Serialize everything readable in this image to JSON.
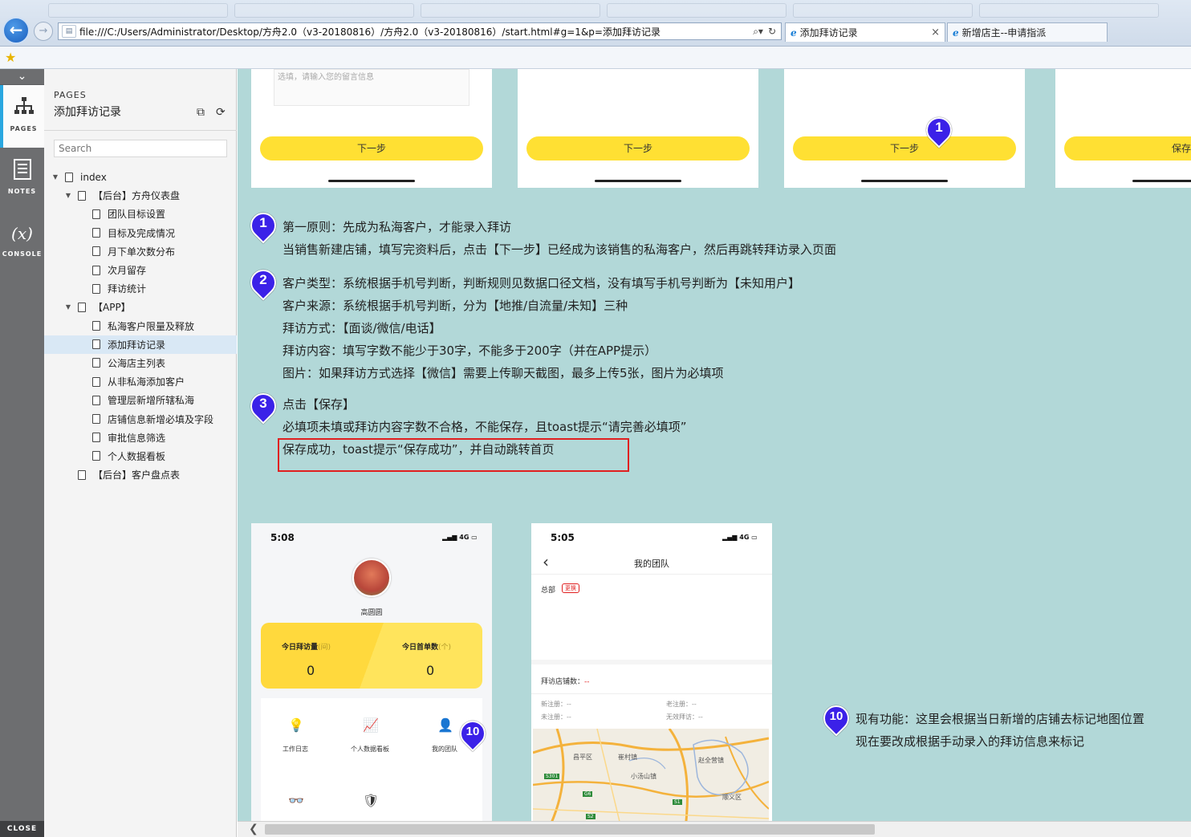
{
  "browser": {
    "url": "file:///C:/Users/Administrator/Desktop/方舟2.0（v3-20180816）/方舟2.0（v3-20180816）/start.html#g=1&p=添加拜访记录",
    "tabs": [
      {
        "label": "添加拜访记录",
        "active": true
      },
      {
        "label": "新增店主--申请指派",
        "active": false
      }
    ]
  },
  "rail": {
    "pages_label": "PAGES",
    "notes_label": "NOTES",
    "console_label": "CONSOLE",
    "console_symbol": "(x)",
    "close_label": "CLOSE"
  },
  "pages_panel": {
    "caption": "PAGES",
    "title": "添加拜访记录",
    "search_placeholder": "Search",
    "tree": [
      {
        "label": "index",
        "level": 0,
        "toggle": "▼"
      },
      {
        "label": "【后台】方舟仪表盘",
        "level": 1,
        "toggle": "▼"
      },
      {
        "label": "团队目标设置",
        "level": 2
      },
      {
        "label": "目标及完成情况",
        "level": 2
      },
      {
        "label": "月下单次数分布",
        "level": 2
      },
      {
        "label": "次月留存",
        "level": 2
      },
      {
        "label": "拜访统计",
        "level": 2
      },
      {
        "label": "【APP】",
        "level": 1,
        "toggle": "▼"
      },
      {
        "label": "私海客户限量及释放",
        "level": 2
      },
      {
        "label": "添加拜访记录",
        "level": 2,
        "selected": true
      },
      {
        "label": "公海店主列表",
        "level": 2
      },
      {
        "label": "从非私海添加客户",
        "level": 2
      },
      {
        "label": "管理层新增所辖私海",
        "level": 2
      },
      {
        "label": "店铺信息新增必填及字段",
        "level": 2
      },
      {
        "label": "审批信息筛选",
        "level": 2
      },
      {
        "label": "个人数据看板",
        "level": 2
      },
      {
        "label": "【后台】客户盘点表",
        "level": 1
      }
    ]
  },
  "top_cards": {
    "textarea_placeholder": "选填，请输入您的留言信息",
    "button_labels": [
      "下一步",
      "下一步",
      "下一步",
      "保存"
    ]
  },
  "markers": {
    "m1": "1",
    "m2": "2",
    "m3": "3",
    "m10": "10"
  },
  "notes": {
    "n1": [
      "第一原则：先成为私海客户，才能录入拜访",
      "当销售新建店铺，填写完资料后，点击【下一步】已经成为该销售的私海客户，然后再跳转拜访录入页面"
    ],
    "n2": [
      "客户类型：系统根据手机号判断，判断规则见数据口径文档，没有填写手机号判断为【未知用户】",
      "客户来源：系统根据手机号判断，分为【地推/自流量/未知】三种",
      "拜访方式：【面谈/微信/电话】",
      "拜访内容：填写字数不能少于30字，不能多于200字（并在APP提示）",
      "图片：如果拜访方式选择【微信】需要上传聊天截图，最多上传5张，图片为必填项"
    ],
    "n3": [
      "点击【保存】",
      "必填项未填或拜访内容字数不合格，不能保存，且toast提示“请完善必填项”",
      "保存成功，toast提示“保存成功”，并自动跳转首页"
    ],
    "n10": [
      "现有功能：这里会根据当日新增的店铺去标记地图位置",
      "现在要改成根据手动录入的拜访信息来标记"
    ]
  },
  "phone1": {
    "time": "5:08",
    "signal": "4G",
    "user_name": "高圆圆",
    "stat_visits_label": "今日拜访量",
    "stat_visits_unit": "(间)",
    "stat_visits_value": "0",
    "stat_orders_label": "今日首单数",
    "stat_orders_unit": "(个)",
    "stat_orders_value": "0",
    "grid": [
      {
        "label": "工作日志",
        "icon": "bulb-icon",
        "glyph": "💡"
      },
      {
        "label": "个人数据看板",
        "icon": "chart-icon",
        "glyph": "📈"
      },
      {
        "label": "我的团队",
        "icon": "team-icon",
        "glyph": "👤"
      }
    ],
    "grid_row2": [
      {
        "icon": "binoculars-icon",
        "glyph": "👓"
      },
      {
        "icon": "shield-icon",
        "glyph": "🛡"
      }
    ]
  },
  "phone2": {
    "time": "5:05",
    "signal": "4G",
    "back_glyph": "‹",
    "title": "我的团队",
    "org_label": "总部",
    "change_label": "更换",
    "visit_count_label": "拜访店铺数：",
    "visit_count_value": "--",
    "stats": [
      {
        "label": "新注册：",
        "value": "--"
      },
      {
        "label": "老注册：",
        "value": "--"
      },
      {
        "label": "未注册：",
        "value": "--"
      },
      {
        "label": "无效拜访：",
        "value": "--"
      }
    ],
    "map_labels": [
      "昌平区",
      "崔村镇",
      "赵全营镇",
      "小汤山镇",
      "顺义区",
      "S301",
      "G6",
      "S1",
      "S2"
    ]
  },
  "colors": {
    "canvas_bg": "#b2d8d8",
    "accent_yellow": "#ffe033",
    "marker_blue": "#3b21e8",
    "highlight_red": "#e02020",
    "rail_bg": "#6d6e70"
  }
}
